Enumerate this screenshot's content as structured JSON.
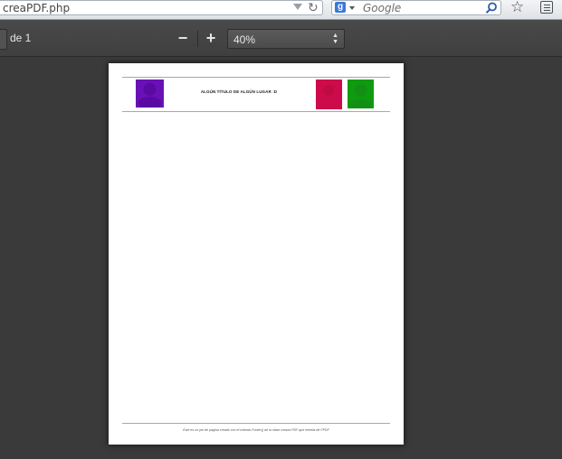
{
  "browser": {
    "url": "creaPDF.php",
    "search_placeholder": "Google",
    "search_engine_icon": "google-g-icon"
  },
  "pdf_toolbar": {
    "page_count": "de 1",
    "zoom_out_symbol": "−",
    "zoom_in_symbol": "+",
    "zoom_value": "40%"
  },
  "document": {
    "header_title": "ALGÚN TÍTULO DE ALGÚN LUGAR :D",
    "footer_text": "Este es un pie de pagina creado con el método Footer() de la clase creaza PDF que hereda de FPDF",
    "logo_colors": [
      "#6a11b5",
      "#cc0c4a",
      "#0f9b0f"
    ]
  }
}
